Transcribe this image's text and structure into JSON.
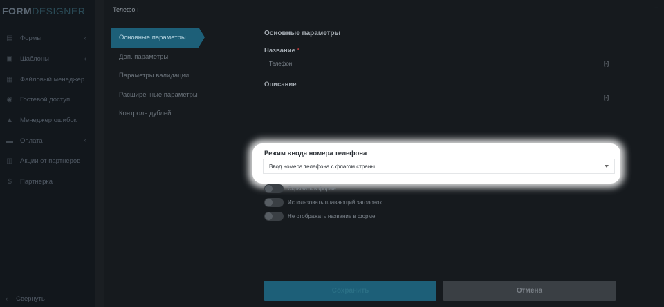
{
  "sidebar": {
    "logo_a": "FORM",
    "logo_b": "DESIGNER",
    "items": [
      {
        "label": "Формы",
        "icon": "forms-icon",
        "chevron": true
      },
      {
        "label": "Шаблоны",
        "icon": "templates-icon",
        "chevron": true
      },
      {
        "label": "Файловый менеджер",
        "icon": "files-icon",
        "chevron": false
      },
      {
        "label": "Гостевой доступ",
        "icon": "guest-icon",
        "chevron": false
      },
      {
        "label": "Менеджер ошибок",
        "icon": "warning-icon",
        "chevron": false
      },
      {
        "label": "Оплата",
        "icon": "payment-icon",
        "chevron": true
      },
      {
        "label": "Акции от партнеров",
        "icon": "gift-icon",
        "chevron": false
      },
      {
        "label": "Партнерка",
        "icon": "dollar-icon",
        "chevron": false
      }
    ],
    "collapse_label": "Свернуть"
  },
  "panel": {
    "title": "Телефон",
    "tabs": [
      {
        "label": "Основные параметры",
        "active": true
      },
      {
        "label": "Доп. параметры",
        "active": false
      },
      {
        "label": "Параметры валидации",
        "active": false
      },
      {
        "label": "Расширенные параметры",
        "active": false
      },
      {
        "label": "Контроль дублей",
        "active": false
      }
    ],
    "section_title": "Основные параметры",
    "name_label": "Название",
    "required_mark": "*",
    "name_value": "Телефон",
    "expand_marker": "[-]",
    "description_label": "Описание",
    "phone_mode_label": "Режим ввода номера телефона",
    "phone_mode_value": "Ввод номера телефона с флагом страны",
    "toggles": [
      {
        "label": "Скрывать в форме",
        "on": false
      },
      {
        "label": "Использовать плавающий заголовок",
        "on": false
      },
      {
        "label": "Не отображать название в форме",
        "on": false
      }
    ],
    "save_label": "Сохранить",
    "cancel_label": "Отмена"
  }
}
